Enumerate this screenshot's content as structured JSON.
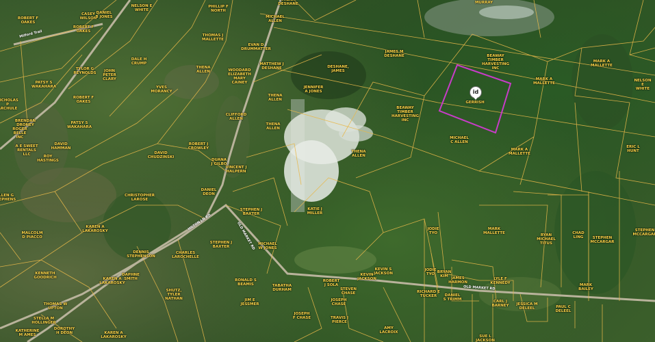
{
  "map": {
    "pin_label": "id",
    "selected_parcel_color": "#c83cc8",
    "parcel_line_color": "#e8b84a",
    "roads": [
      {
        "id": "road1",
        "label": "Milford Trail"
      },
      {
        "id": "road2",
        "label": "HILTON LN RD"
      },
      {
        "id": "road3",
        "label": "OLD MARKET RD"
      },
      {
        "id": "road4",
        "label": "OLD MARKET RD"
      }
    ],
    "owners": [
      {
        "id": "o1",
        "text": "ROBERT F\nOAKES"
      },
      {
        "id": "o2",
        "text": "CASEY\nWILSON"
      },
      {
        "id": "o3",
        "text": "DANIEL\nB JONES"
      },
      {
        "id": "o4",
        "text": "ROBERT F\nOAKES"
      },
      {
        "id": "o5",
        "text": "NELSON E\nWHITE"
      },
      {
        "id": "o6",
        "text": "PHILLIP F\nNORTH"
      },
      {
        "id": "o7",
        "text": "MICHAEL\nALLEN"
      },
      {
        "id": "o8",
        "text": "THENA\nDESHANE"
      },
      {
        "id": "o9",
        "text": "MURRAY"
      },
      {
        "id": "o10",
        "text": "THOMAS J\nMALLETTE"
      },
      {
        "id": "o11",
        "text": "EVAN D\nDRUMMATTER"
      },
      {
        "id": "o12",
        "text": "JAMES M\nDESHANE"
      },
      {
        "id": "o13",
        "text": "BEAWAY\nTIMBER\nHARVESTING\nINC"
      },
      {
        "id": "o14",
        "text": "MARK A\nMALLETTE"
      },
      {
        "id": "o15",
        "text": "MATTHEW J\nDESHANE"
      },
      {
        "id": "o16",
        "text": "DESHANE,\nJAMES"
      },
      {
        "id": "o17",
        "text": "PATSY S\nWAKAHARA"
      },
      {
        "id": "o18",
        "text": "TYLOR G\nREYNOLDS"
      },
      {
        "id": "o19",
        "text": "JOHN\nPETER\nCLARY"
      },
      {
        "id": "o20",
        "text": "DALE H\nCRUMP"
      },
      {
        "id": "o21",
        "text": "THENA\nALLEN"
      },
      {
        "id": "o22",
        "text": "WOODARD\nELIZABETH\nMARY\nCAINEY"
      },
      {
        "id": "o23",
        "text": "JENNIFER\nA JONES"
      },
      {
        "id": "o24",
        "text": "MARK A\nMALLETTE"
      },
      {
        "id": "o25",
        "text": "NELSON E\nWHITE"
      },
      {
        "id": "o26",
        "text": "NICHOLAS\nP\nARCHULE"
      },
      {
        "id": "o27",
        "text": "ROBERT F\nOAKES"
      },
      {
        "id": "o28",
        "text": "YVES\nMORANCY"
      },
      {
        "id": "o29",
        "text": "THENA\nALLEN"
      },
      {
        "id": "o30",
        "text": "GERRISH"
      },
      {
        "id": "o31",
        "text": "BEAWAY\nTIMBER\nHARVESTING\nINC"
      },
      {
        "id": "o32",
        "text": "BRENDAN\nDRONEY"
      },
      {
        "id": "o33",
        "text": "ROGER\nBELLE\nINC"
      },
      {
        "id": "o34",
        "text": "PATSY S\nWAKAHARA"
      },
      {
        "id": "o35",
        "text": "CLIFFORD\nALLEN"
      },
      {
        "id": "o36",
        "text": "THENA\nALLEN"
      },
      {
        "id": "o37",
        "text": "A E SWEET\nRENTALS\nLLC"
      },
      {
        "id": "o38",
        "text": "DAVID\nHAMMAN"
      },
      {
        "id": "o39",
        "text": "ROBERT J\nCROWLEY"
      },
      {
        "id": "o40",
        "text": "MICHAEL\nC ALLEN"
      },
      {
        "id": "o41",
        "text": "ERIC L\nHUNT"
      },
      {
        "id": "o42",
        "text": "ROY\nHASTINGS"
      },
      {
        "id": "o43",
        "text": "DAVID\nCHUDZINSKI"
      },
      {
        "id": "o44",
        "text": "DUANA\nJ GILBO"
      },
      {
        "id": "o45",
        "text": "THENA\nALLEN"
      },
      {
        "id": "o46",
        "text": "MARK A\nMALLETTE"
      },
      {
        "id": "o47",
        "text": "VINCENT J\nHALPERN"
      },
      {
        "id": "o48",
        "text": "DANIEL\nDEON"
      },
      {
        "id": "o49",
        "text": "CHRISTOPHER\nLAROSE"
      },
      {
        "id": "o50",
        "text": "ALLEN G\nSTEPHENS"
      },
      {
        "id": "o51",
        "text": "STEPHEN J\nBAXTER"
      },
      {
        "id": "o52",
        "text": "KATIE J\nMILLER"
      },
      {
        "id": "o53",
        "text": "JODIE\nTYO"
      },
      {
        "id": "o54",
        "text": "MARK\nMALLETTE"
      },
      {
        "id": "o55",
        "text": "RYAN\nMICHAEL\nTITUS"
      },
      {
        "id": "o56",
        "text": "CHAD\nLING"
      },
      {
        "id": "o57",
        "text": "STEPHEN\nMCCARGAR"
      },
      {
        "id": "o58",
        "text": "STEPHEN\nMCCARGAR"
      },
      {
        "id": "o59",
        "text": "KAREN A\nLAKAROSKY"
      },
      {
        "id": "o60",
        "text": "MALCOLM\nD PIACCO"
      },
      {
        "id": "o61",
        "text": "STEPHEN J\nBAXTER"
      },
      {
        "id": "o62",
        "text": "MICHAEL\nW JONES"
      },
      {
        "id": "o63",
        "text": "DENNIS\nSTEPHENSON"
      },
      {
        "id": "o64",
        "text": "CHARLES\nLAROCHELLE"
      },
      {
        "id": "o65",
        "text": "KEVIN S\nJACKSON"
      },
      {
        "id": "o66",
        "text": "JODIE\nTYO"
      },
      {
        "id": "o67",
        "text": "BRYAN\nKIM"
      },
      {
        "id": "o68",
        "text": "KENNETH\nGOODRICH"
      },
      {
        "id": "o69",
        "text": "DAPHNE\nSMITH"
      },
      {
        "id": "o70",
        "text": "KEVIN\nJACKSON"
      },
      {
        "id": "o71",
        "text": "JAMES\nHARMON"
      },
      {
        "id": "o72",
        "text": "LYLE F\nKENNEDY"
      },
      {
        "id": "o73",
        "text": "MARK\nBAILEY"
      },
      {
        "id": "o74",
        "text": "RONALD S\nBEAMIS"
      },
      {
        "id": "o75",
        "text": "ROBERT\nJ SOLA"
      },
      {
        "id": "o76",
        "text": "TABATHA\nDURHAM"
      },
      {
        "id": "o77",
        "text": "STEVEN\nCHASE"
      },
      {
        "id": "o78",
        "text": "RICHARD E\nTUCKER"
      },
      {
        "id": "o79",
        "text": "DANIEL\nS TRIMM"
      },
      {
        "id": "o80",
        "text": "KAREN A\nLAKAROSKY"
      },
      {
        "id": "o81",
        "text": "SHUTZ,\nTYLER\nNATHAN"
      },
      {
        "id": "o82",
        "text": "JIM E\nJESSMER"
      },
      {
        "id": "o83",
        "text": "JOSEPH\nCHASE"
      },
      {
        "id": "o84",
        "text": "CARL J\nBARNEY"
      },
      {
        "id": "o85",
        "text": "JESSICA M\nDELEEL"
      },
      {
        "id": "o86",
        "text": "PAUL C\nDELEEL"
      },
      {
        "id": "o87",
        "text": "THOMAS W\nUPTON"
      },
      {
        "id": "o88",
        "text": "STELLA M\nHOLLINGER"
      },
      {
        "id": "o89",
        "text": "JOSEPH\nF CHASE"
      },
      {
        "id": "o90",
        "text": "TRAVIS J\nPIERCE"
      },
      {
        "id": "o91",
        "text": "KATHERINE\nM AMES"
      },
      {
        "id": "o92",
        "text": "DOROTHY\nH DEON"
      },
      {
        "id": "o93",
        "text": "KAREN A\nLAKAROSKY"
      },
      {
        "id": "o94",
        "text": "AMY\nLACROIX"
      },
      {
        "id": "o95",
        "text": "SUE L\nJACKSON"
      }
    ]
  }
}
